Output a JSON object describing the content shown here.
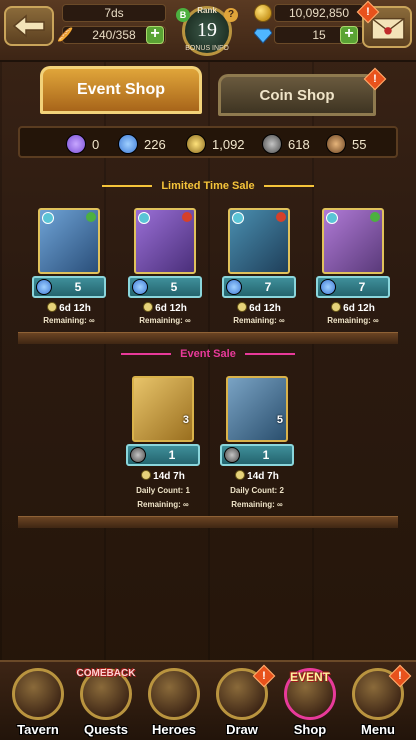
{
  "header": {
    "back_label": "",
    "timer_text": "7ds",
    "stamina_text": "240/358",
    "rank_label": "Rank",
    "rank_value": "19",
    "rank_sub": "BONUS INFO",
    "gold_value": "10,092,850",
    "gem_value": "15"
  },
  "tabs": [
    {
      "label": "Event Shop",
      "active": true
    },
    {
      "label": "Coin Shop",
      "active": false
    }
  ],
  "currencies": [
    {
      "icon": "purple-orb-icon",
      "value": "0",
      "color": "#7a4fd6"
    },
    {
      "icon": "blue-orb-icon",
      "value": "226",
      "color": "#3f7ad6"
    },
    {
      "icon": "gold-medal-icon",
      "value": "1,092",
      "color": "#b99a3a"
    },
    {
      "icon": "gray-medal-icon",
      "value": "618",
      "color": "#7a7a7a"
    },
    {
      "icon": "bronze-medal-icon",
      "value": "55",
      "color": "#a3702e"
    }
  ],
  "limited_sale": {
    "title": "Limited Time Sale",
    "items": [
      {
        "name": "hero-card-ban",
        "price": "5",
        "timer": "6d 12h",
        "remaining": "Remaining: ∞",
        "bg": "#6fa3d6",
        "attr": "#4cb040",
        "price_icon": "blue-orb-icon"
      },
      {
        "name": "hero-card-escanor",
        "price": "5",
        "timer": "6d 12h",
        "remaining": "Remaining: ∞",
        "bg": "#9a6fd6",
        "attr": "#d6402a",
        "price_icon": "blue-orb-icon"
      },
      {
        "name": "hero-card-armor",
        "price": "7",
        "timer": "6d 12h",
        "remaining": "Remaining: ∞",
        "bg": "#4a8fb0",
        "attr": "#d6402a",
        "price_icon": "blue-orb-icon"
      },
      {
        "name": "hero-card-escanor-2",
        "price": "7",
        "timer": "6d 12h",
        "remaining": "Remaining: ∞",
        "bg": "#b07ad6",
        "attr": "#4cb040",
        "price_icon": "blue-orb-icon"
      }
    ]
  },
  "event_sale": {
    "title": "Event Sale",
    "items": [
      {
        "name": "item-card-gem-bowl",
        "qty": "3",
        "price": "1",
        "timer": "14d 7h",
        "daily": "Daily Count: 1",
        "remaining": "Remaining: ∞",
        "bg": "#d6a53a",
        "price_icon": "gray-medal-icon"
      },
      {
        "name": "item-card-medal",
        "qty": "5",
        "price": "1",
        "timer": "14d 7h",
        "daily": "Daily Count: 2",
        "remaining": "Remaining: ∞",
        "bg": "#4a7fa3",
        "price_icon": "gray-medal-icon"
      }
    ]
  },
  "nav": [
    {
      "label": "Tavern",
      "icon": "tavern-icon",
      "badge": ""
    },
    {
      "label": "Quests",
      "icon": "quests-icon",
      "badge": "COMEBACK"
    },
    {
      "label": "Heroes",
      "icon": "heroes-icon",
      "badge": ""
    },
    {
      "label": "Draw",
      "icon": "draw-icon",
      "badge": "!"
    },
    {
      "label": "Shop",
      "icon": "shop-icon",
      "badge": "EVENT"
    },
    {
      "label": "Menu",
      "icon": "menu-icon",
      "badge": "!"
    }
  ]
}
